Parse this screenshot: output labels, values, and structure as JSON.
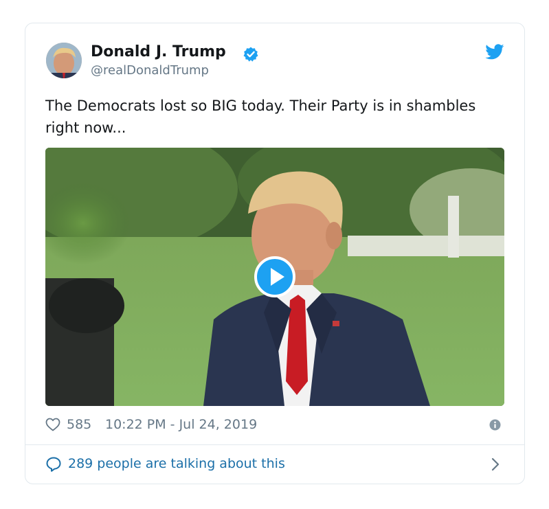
{
  "author": {
    "name": "Donald J. Trump",
    "handle": "@realDonaldTrump",
    "verified": true,
    "avatar_icon": "profile-photo"
  },
  "tweet": {
    "text": "The Democrats lost so BIG today. Their Party is in shambles right now..."
  },
  "media": {
    "type": "video",
    "play_icon": "play-icon"
  },
  "stats": {
    "likes": "585",
    "timestamp": "10:22 PM - Jul 24, 2019"
  },
  "footer": {
    "talk_label": "289 people are talking about this"
  },
  "colors": {
    "accent": "#1da1f2",
    "link": "#1b6fa8",
    "muted": "#657786",
    "border": "#e1e8ed"
  }
}
